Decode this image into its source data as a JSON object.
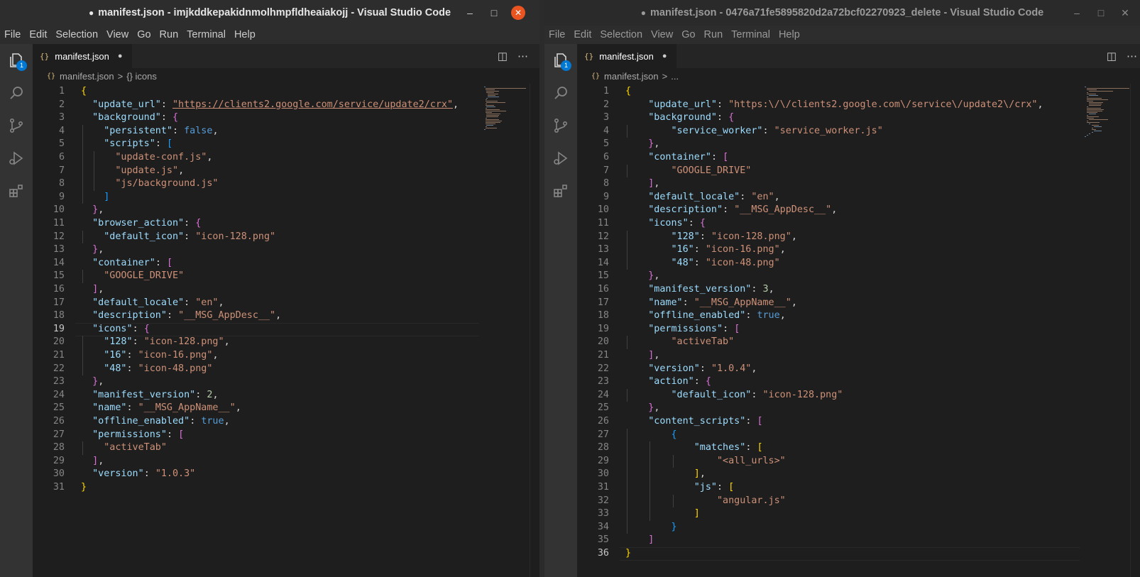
{
  "left": {
    "title": "manifest.json - imjkddkepakidnmolhmpfldheaiakojj - Visual Studio Code",
    "unsaved_dot": "●",
    "menu": [
      "File",
      "Edit",
      "Selection",
      "View",
      "Go",
      "Run",
      "Terminal",
      "Help"
    ],
    "tab_label": "manifest.json",
    "tab_icon": "{}",
    "tab_modified": "●",
    "breadcrumb": [
      "manifest.json",
      "{} icons"
    ],
    "explorer_badge": "1",
    "current_line": 19,
    "line_numbers": [
      "1",
      "2",
      "3",
      "4",
      "5",
      "6",
      "7",
      "8",
      "9",
      "10",
      "11",
      "12",
      "13",
      "14",
      "15",
      "16",
      "17",
      "18",
      "19",
      "20",
      "21",
      "22",
      "23",
      "24",
      "25",
      "26",
      "27",
      "28",
      "29",
      "30",
      "31"
    ]
  },
  "right": {
    "title": "manifest.json - 0476a71fe5895820d2a72bcf02270923_delete - Visual Studio Code",
    "unsaved_dot": "●",
    "menu": [
      "File",
      "Edit",
      "Selection",
      "View",
      "Go",
      "Run",
      "Terminal",
      "Help"
    ],
    "tab_label": "manifest.json",
    "tab_icon": "{}",
    "tab_modified": "●",
    "breadcrumb": [
      "manifest.json",
      "..."
    ],
    "explorer_badge": "1",
    "current_line": 36,
    "line_numbers": [
      "1",
      "2",
      "3",
      "4",
      "5",
      "6",
      "7",
      "8",
      "9",
      "10",
      "11",
      "12",
      "13",
      "14",
      "15",
      "16",
      "17",
      "18",
      "19",
      "20",
      "21",
      "22",
      "23",
      "24",
      "25",
      "26",
      "27",
      "28",
      "29",
      "30",
      "31",
      "32",
      "33",
      "34",
      "35",
      "36"
    ]
  },
  "window_controls": {
    "minimize": "–",
    "maximize": "□",
    "close": "✕"
  },
  "icons": [
    "files-icon",
    "search-icon",
    "source-control-icon",
    "run-debug-icon",
    "extensions-icon",
    "split-editor-icon",
    "more-actions-icon"
  ],
  "left_code": [
    [
      [
        "br1",
        "{"
      ]
    ],
    [
      [
        "k",
        "  \"update_url\""
      ],
      [
        "p",
        ": "
      ],
      [
        "s u",
        "\"https://clients2.google.com/service/update2/crx\""
      ],
      [
        "p",
        ","
      ]
    ],
    [
      [
        "k",
        "  \"background\""
      ],
      [
        "p",
        ": "
      ],
      [
        "br2",
        "{"
      ]
    ],
    [
      [
        "k",
        "    \"persistent\""
      ],
      [
        "p",
        ": "
      ],
      [
        "b",
        "false"
      ],
      [
        "p",
        ","
      ]
    ],
    [
      [
        "k",
        "    \"scripts\""
      ],
      [
        "p",
        ": "
      ],
      [
        "br3",
        "["
      ]
    ],
    [
      [
        "s",
        "      \"update-conf.js\""
      ],
      [
        "p",
        ","
      ]
    ],
    [
      [
        "s",
        "      \"update.js\""
      ],
      [
        "p",
        ","
      ]
    ],
    [
      [
        "s",
        "      \"js/background.js\""
      ]
    ],
    [
      [
        "br3",
        "    ]"
      ]
    ],
    [
      [
        "br2",
        "  }"
      ],
      [
        "p",
        ","
      ]
    ],
    [
      [
        "k",
        "  \"browser_action\""
      ],
      [
        "p",
        ": "
      ],
      [
        "br2",
        "{"
      ]
    ],
    [
      [
        "k",
        "    \"default_icon\""
      ],
      [
        "p",
        ": "
      ],
      [
        "s",
        "\"icon-128.png\""
      ]
    ],
    [
      [
        "br2",
        "  }"
      ],
      [
        "p",
        ","
      ]
    ],
    [
      [
        "k",
        "  \"container\""
      ],
      [
        "p",
        ": "
      ],
      [
        "br2",
        "["
      ]
    ],
    [
      [
        "s",
        "    \"GOOGLE_DRIVE\""
      ]
    ],
    [
      [
        "br2",
        "  ]"
      ],
      [
        "p",
        ","
      ]
    ],
    [
      [
        "k",
        "  \"default_locale\""
      ],
      [
        "p",
        ": "
      ],
      [
        "s",
        "\"en\""
      ],
      [
        "p",
        ","
      ]
    ],
    [
      [
        "k",
        "  \"description\""
      ],
      [
        "p",
        ": "
      ],
      [
        "s",
        "\"__MSG_AppDesc__\""
      ],
      [
        "p",
        ","
      ]
    ],
    [
      [
        "k",
        "  \"icons\""
      ],
      [
        "p",
        ": "
      ],
      [
        "br2",
        "{"
      ]
    ],
    [
      [
        "k",
        "    \"128\""
      ],
      [
        "p",
        ": "
      ],
      [
        "s",
        "\"icon-128.png\""
      ],
      [
        "p",
        ","
      ]
    ],
    [
      [
        "k",
        "    \"16\""
      ],
      [
        "p",
        ": "
      ],
      [
        "s",
        "\"icon-16.png\""
      ],
      [
        "p",
        ","
      ]
    ],
    [
      [
        "k",
        "    \"48\""
      ],
      [
        "p",
        ": "
      ],
      [
        "s",
        "\"icon-48.png\""
      ]
    ],
    [
      [
        "br2",
        "  }"
      ],
      [
        "p",
        ","
      ]
    ],
    [
      [
        "k",
        "  \"manifest_version\""
      ],
      [
        "p",
        ": "
      ],
      [
        "n",
        "2"
      ],
      [
        "p",
        ","
      ]
    ],
    [
      [
        "k",
        "  \"name\""
      ],
      [
        "p",
        ": "
      ],
      [
        "s",
        "\"__MSG_AppName__\""
      ],
      [
        "p",
        ","
      ]
    ],
    [
      [
        "k",
        "  \"offline_enabled\""
      ],
      [
        "p",
        ": "
      ],
      [
        "b",
        "true"
      ],
      [
        "p",
        ","
      ]
    ],
    [
      [
        "k",
        "  \"permissions\""
      ],
      [
        "p",
        ": "
      ],
      [
        "br2",
        "["
      ]
    ],
    [
      [
        "s",
        "    \"activeTab\""
      ]
    ],
    [
      [
        "br2",
        "  ]"
      ],
      [
        "p",
        ","
      ]
    ],
    [
      [
        "k",
        "  \"version\""
      ],
      [
        "p",
        ": "
      ],
      [
        "s",
        "\"1.0.3\""
      ]
    ],
    [
      [
        "br1",
        "}"
      ]
    ]
  ],
  "right_code": [
    [
      [
        "br1",
        "{"
      ]
    ],
    [
      [
        "k",
        "    \"update_url\""
      ],
      [
        "p",
        ": "
      ],
      [
        "s",
        "\"https:\\/\\/clients2.google.com\\/service\\/update2\\/crx\""
      ],
      [
        "p",
        ","
      ]
    ],
    [
      [
        "k",
        "    \"background\""
      ],
      [
        "p",
        ": "
      ],
      [
        "br2",
        "{"
      ]
    ],
    [
      [
        "k",
        "        \"service_worker\""
      ],
      [
        "p",
        ": "
      ],
      [
        "s",
        "\"service_worker.js\""
      ]
    ],
    [
      [
        "br2",
        "    }"
      ],
      [
        "p",
        ","
      ]
    ],
    [
      [
        "k",
        "    \"container\""
      ],
      [
        "p",
        ": "
      ],
      [
        "br2",
        "["
      ]
    ],
    [
      [
        "s",
        "        \"GOOGLE_DRIVE\""
      ]
    ],
    [
      [
        "br2",
        "    ]"
      ],
      [
        "p",
        ","
      ]
    ],
    [
      [
        "k",
        "    \"default_locale\""
      ],
      [
        "p",
        ": "
      ],
      [
        "s",
        "\"en\""
      ],
      [
        "p",
        ","
      ]
    ],
    [
      [
        "k",
        "    \"description\""
      ],
      [
        "p",
        ": "
      ],
      [
        "s",
        "\"__MSG_AppDesc__\""
      ],
      [
        "p",
        ","
      ]
    ],
    [
      [
        "k",
        "    \"icons\""
      ],
      [
        "p",
        ": "
      ],
      [
        "br2",
        "{"
      ]
    ],
    [
      [
        "k",
        "        \"128\""
      ],
      [
        "p",
        ": "
      ],
      [
        "s",
        "\"icon-128.png\""
      ],
      [
        "p",
        ","
      ]
    ],
    [
      [
        "k",
        "        \"16\""
      ],
      [
        "p",
        ": "
      ],
      [
        "s",
        "\"icon-16.png\""
      ],
      [
        "p",
        ","
      ]
    ],
    [
      [
        "k",
        "        \"48\""
      ],
      [
        "p",
        ": "
      ],
      [
        "s",
        "\"icon-48.png\""
      ]
    ],
    [
      [
        "br2",
        "    }"
      ],
      [
        "p",
        ","
      ]
    ],
    [
      [
        "k",
        "    \"manifest_version\""
      ],
      [
        "p",
        ": "
      ],
      [
        "n",
        "3"
      ],
      [
        "p",
        ","
      ]
    ],
    [
      [
        "k",
        "    \"name\""
      ],
      [
        "p",
        ": "
      ],
      [
        "s",
        "\"__MSG_AppName__\""
      ],
      [
        "p",
        ","
      ]
    ],
    [
      [
        "k",
        "    \"offline_enabled\""
      ],
      [
        "p",
        ": "
      ],
      [
        "b",
        "true"
      ],
      [
        "p",
        ","
      ]
    ],
    [
      [
        "k",
        "    \"permissions\""
      ],
      [
        "p",
        ": "
      ],
      [
        "br2",
        "["
      ]
    ],
    [
      [
        "s",
        "        \"activeTab\""
      ]
    ],
    [
      [
        "br2",
        "    ]"
      ],
      [
        "p",
        ","
      ]
    ],
    [
      [
        "k",
        "    \"version\""
      ],
      [
        "p",
        ": "
      ],
      [
        "s",
        "\"1.0.4\""
      ],
      [
        "p",
        ","
      ]
    ],
    [
      [
        "k",
        "    \"action\""
      ],
      [
        "p",
        ": "
      ],
      [
        "br2",
        "{"
      ]
    ],
    [
      [
        "k",
        "        \"default_icon\""
      ],
      [
        "p",
        ": "
      ],
      [
        "s",
        "\"icon-128.png\""
      ]
    ],
    [
      [
        "br2",
        "    }"
      ],
      [
        "p",
        ","
      ]
    ],
    [
      [
        "k",
        "    \"content_scripts\""
      ],
      [
        "p",
        ": "
      ],
      [
        "br2",
        "["
      ]
    ],
    [
      [
        "br3",
        "        {"
      ]
    ],
    [
      [
        "k",
        "            \"matches\""
      ],
      [
        "p",
        ": "
      ],
      [
        "br1",
        "["
      ]
    ],
    [
      [
        "s",
        "                \"<all_urls>\""
      ]
    ],
    [
      [
        "br1",
        "            ]"
      ],
      [
        "p",
        ","
      ]
    ],
    [
      [
        "k",
        "            \"js\""
      ],
      [
        "p",
        ": "
      ],
      [
        "br1",
        "["
      ]
    ],
    [
      [
        "s",
        "                \"angular.js\""
      ]
    ],
    [
      [
        "br1",
        "            ]"
      ]
    ],
    [
      [
        "br3",
        "        }"
      ]
    ],
    [
      [
        "br2",
        "    ]"
      ]
    ],
    [
      [
        "br1",
        "}"
      ]
    ]
  ]
}
